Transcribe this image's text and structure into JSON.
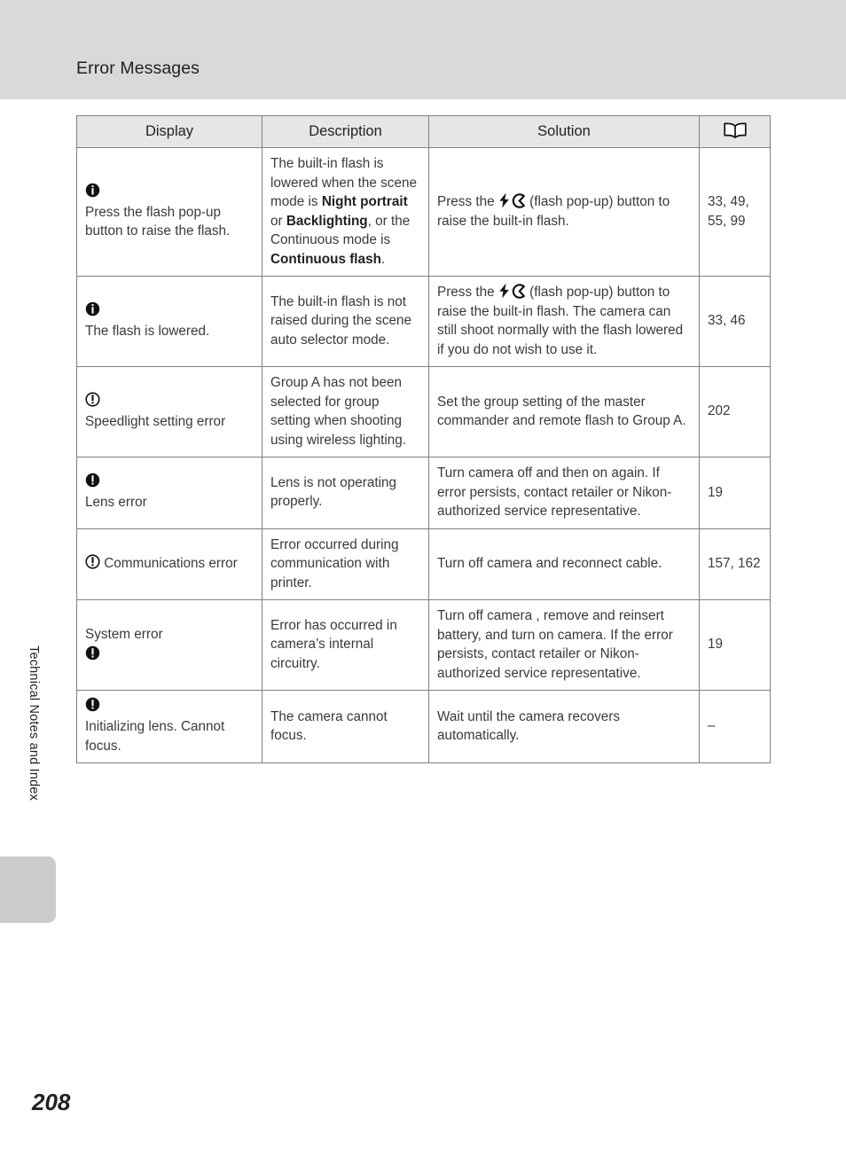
{
  "header": {
    "title": "Error Messages"
  },
  "side": {
    "chapter_label": "Technical Notes and Index"
  },
  "footer": {
    "page_number": "208"
  },
  "table": {
    "columns": {
      "display": "Display",
      "description": "Description",
      "solution": "Solution",
      "reference": "book-icon"
    },
    "rows": [
      {
        "icon": "info-filled-icon",
        "icon_position": "above",
        "display": "Press the flash pop-up button to raise the flash.",
        "description_parts": [
          {
            "text": "The built-in flash is lowered when the scene mode is ",
            "bold": false
          },
          {
            "text": "Night portrait",
            "bold": true
          },
          {
            "text": " or ",
            "bold": false
          },
          {
            "text": "Backlighting",
            "bold": true
          },
          {
            "text": ", or the Continuous mode is ",
            "bold": false
          },
          {
            "text": "Continuous flash",
            "bold": true
          },
          {
            "text": ".",
            "bold": false
          }
        ],
        "solution_pre": "Press the ",
        "solution_post": " (flash pop-up) button to raise the built-in flash.",
        "solution_icons": [
          "flash-bolt-icon",
          "flash-popup-icon"
        ],
        "reference": "33, 49, 55, 99"
      },
      {
        "icon": "info-filled-icon",
        "icon_position": "above",
        "display": "The flash is lowered.",
        "description_parts": [
          {
            "text": "The built-in flash is not raised during the scene auto selector mode.",
            "bold": false
          }
        ],
        "solution_pre": "Press the ",
        "solution_post": " (flash pop-up) button to raise the built-in flash. The camera can still shoot normally with the flash lowered if you do not wish to use it.",
        "solution_icons": [
          "flash-bolt-icon",
          "flash-popup-icon"
        ],
        "reference": "33, 46"
      },
      {
        "icon": "warning-outline-icon",
        "icon_position": "above",
        "display": "Speedlight setting error",
        "description_parts": [
          {
            "text": "Group A has not been selected for group setting when shooting using wireless lighting.",
            "bold": false
          }
        ],
        "solution_pre": "Set the group setting of the master commander and remote flash to Group A.",
        "solution_post": "",
        "solution_icons": [],
        "reference": "202"
      },
      {
        "icon": "warning-filled-icon",
        "icon_position": "above",
        "display": "Lens error",
        "description_parts": [
          {
            "text": "Lens is not operating properly.",
            "bold": false
          }
        ],
        "solution_pre": "Turn camera off and then on again. If error persists, contact retailer or Nikon-authorized service representative.",
        "solution_post": "",
        "solution_icons": [],
        "reference": "19"
      },
      {
        "icon": "warning-outline-icon",
        "icon_position": "inline",
        "display": "Communications error",
        "description_parts": [
          {
            "text": "Error occurred during communication with printer.",
            "bold": false
          }
        ],
        "solution_pre": "Turn off camera and reconnect cable.",
        "solution_post": "",
        "solution_icons": [],
        "reference": "157, 162"
      },
      {
        "icon": "warning-filled-icon",
        "icon_position": "below",
        "display": "System error",
        "description_parts": [
          {
            "text": "Error has occurred in camera’s internal circuitry.",
            "bold": false
          }
        ],
        "solution_pre": "Turn off camera , remove and reinsert battery, and turn on camera. If the error persists, contact retailer or Nikon-authorized service representative.",
        "solution_post": "",
        "solution_icons": [],
        "reference": "19"
      },
      {
        "icon": "warning-filled-icon",
        "icon_position": "above",
        "display": "Initializing lens. Cannot focus.",
        "description_parts": [
          {
            "text": "The camera cannot focus.",
            "bold": false
          }
        ],
        "solution_pre": "Wait until the camera recovers automatically.",
        "solution_post": "",
        "solution_icons": [],
        "reference": "–"
      }
    ]
  },
  "colors": {
    "header_band": "#d9d9d9",
    "table_header": "#e6e6e6",
    "border": "#808080",
    "text": "#3a3a3a",
    "side_tab": "#cccccc"
  }
}
